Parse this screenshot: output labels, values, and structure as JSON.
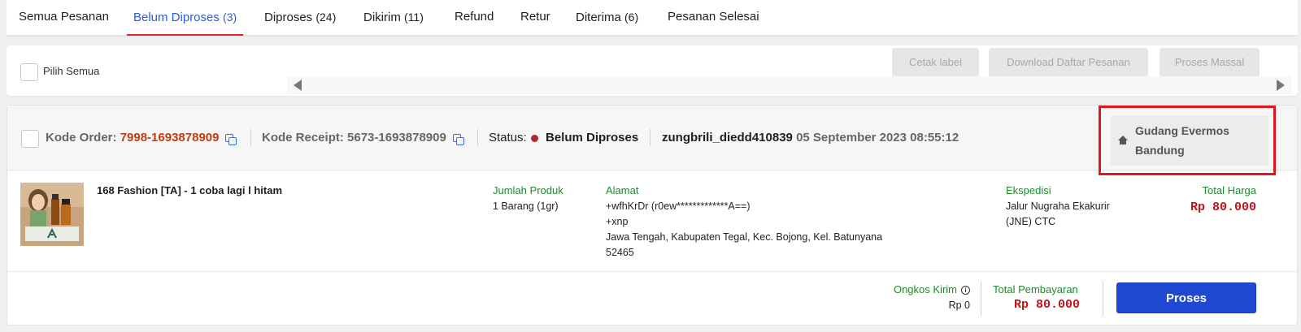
{
  "tabs": [
    {
      "label": "Semua Pesanan",
      "count": ""
    },
    {
      "label": "Belum Diproses",
      "count": "(3)"
    },
    {
      "label": "Diproses",
      "count": "(24)"
    },
    {
      "label": "Dikirim",
      "count": "(11)"
    },
    {
      "label": "Refund",
      "count": ""
    },
    {
      "label": "Retur",
      "count": ""
    },
    {
      "label": "Diterima",
      "count": "(6)"
    },
    {
      "label": "Pesanan Selesai",
      "count": ""
    }
  ],
  "active_tab": "Belum Diproses",
  "toolbar": {
    "select_all_label": "Pilih Semua",
    "cetak_label": "Cetak label",
    "download_label": "Download Daftar Pesanan",
    "proses_massal_label": "Proses Massal"
  },
  "order": {
    "kode_order_label": "Kode Order:",
    "kode_order": "7998-1693878909",
    "kode_receipt_label": "Kode Receipt:",
    "kode_receipt": "5673-1693878909",
    "status_label": "Status:",
    "status": "Belum Diproses",
    "buyer": "zungbrili_diedd410839",
    "date": "05 September 2023 08:55:12",
    "warehouse_line1": "Gudang Evermos",
    "warehouse_line2": "Bandung",
    "product_name": "168 Fashion [TA] - 1 coba lagi l hitam",
    "jumlah_label": "Jumlah Produk",
    "jumlah": "1 Barang (1gr)",
    "alamat_label": "Alamat",
    "alamat_lines": [
      "+wfhKrDr (r0ew*************A==)",
      "+xnp",
      "Jawa Tengah, Kabupaten Tegal, Kec. Bojong, Kel. Batunyana",
      "52465"
    ],
    "ekspedisi_label": "Ekspedisi",
    "ekspedisi_lines": [
      "Jalur Nugraha Ekakurir",
      "(JNE) CTC"
    ],
    "total_harga_label": "Total Harga",
    "total_harga": "Rp 80.000",
    "ongkos_label": "Ongkos Kirim",
    "ongkos": "Rp 0",
    "total_bayar_label": "Total Pembayaran",
    "total_bayar": "Rp 80.000",
    "proses_label": "Proses"
  },
  "colors": {
    "accent_blue": "#1f48d3",
    "active_tab_underline": "#e0262d",
    "highlight_box": "#e0161e",
    "label_green": "#1f8a2c",
    "price_red": "#c0141b"
  },
  "icons": [
    "copy-icon",
    "home-icon",
    "info-icon",
    "arrow-left-icon",
    "arrow-right-icon"
  ]
}
